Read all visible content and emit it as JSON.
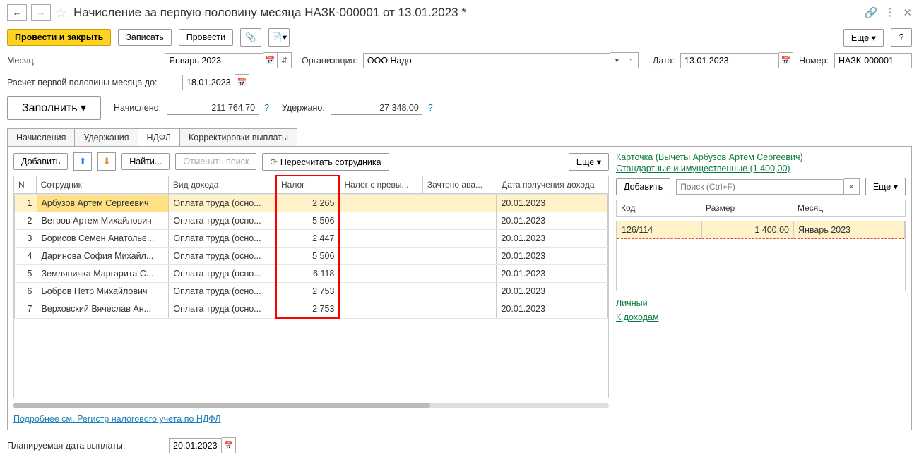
{
  "header": {
    "title": "Начисление за первую половину месяца НАЗК-000001 от 13.01.2023 *"
  },
  "toolbar": {
    "post_close": "Провести и закрыть",
    "save": "Записать",
    "post": "Провести",
    "more": "Еще"
  },
  "form": {
    "month_label": "Месяц:",
    "month_value": "Январь 2023",
    "org_label": "Организация:",
    "org_value": "ООО Надо",
    "date_label": "Дата:",
    "date_value": "13.01.2023",
    "number_label": "Номер:",
    "number_value": "НАЗК-000001",
    "calc_until_label": "Расчет первой половины месяца до:",
    "calc_until_value": "18.01.2023",
    "fill": "Заполнить",
    "accrued_label": "Начислено:",
    "accrued_value": "211 764,70",
    "withheld_label": "Удержано:",
    "withheld_value": "27 348,00"
  },
  "tabs": {
    "t1": "Начисления",
    "t2": "Удержания",
    "t3": "НДФЛ",
    "t4": "Корректировки выплаты"
  },
  "subbar": {
    "add": "Добавить",
    "find": "Найти...",
    "cancel_find": "Отменить поиск",
    "recalc": "Пересчитать сотрудника",
    "more": "Еще"
  },
  "cols": {
    "n": "N",
    "emp": "Сотрудник",
    "inc": "Вид дохода",
    "tax": "Налог",
    "exc": "Налог с превы...",
    "adv": "Зачтено ава...",
    "date": "Дата получения дохода"
  },
  "rows": [
    {
      "n": "1",
      "emp": "Арбузов Артем Сергеевич",
      "inc": "Оплата труда (осно...",
      "tax": "2 265",
      "date": "20.01.2023"
    },
    {
      "n": "2",
      "emp": "Ветров Артем Михайлович",
      "inc": "Оплата труда (осно...",
      "tax": "5 506",
      "date": "20.01.2023"
    },
    {
      "n": "3",
      "emp": "Борисов Семен Анатолье...",
      "inc": "Оплата труда (осно...",
      "tax": "2 447",
      "date": "20.01.2023"
    },
    {
      "n": "4",
      "emp": "Даринова София Михайл...",
      "inc": "Оплата труда (осно...",
      "tax": "5 506",
      "date": "20.01.2023"
    },
    {
      "n": "5",
      "emp": "Земляничка Маргарита С...",
      "inc": "Оплата труда (осно...",
      "tax": "6 118",
      "date": "20.01.2023"
    },
    {
      "n": "6",
      "emp": "Бобров Петр Михайлович",
      "inc": "Оплата труда (осно...",
      "tax": "2 753",
      "date": "20.01.2023"
    },
    {
      "n": "7",
      "emp": "Верховский Вячеслав Ан...",
      "inc": "Оплата труда (осно...",
      "tax": "2 753",
      "date": "20.01.2023"
    }
  ],
  "bottom_link": "Подробнее см. Регистр налогового учета по НДФЛ",
  "card": {
    "title": "Карточка (Вычеты Арбузов Артем Сергеевич)",
    "std_link": "Стандартные и имущественные (1 400,00)",
    "add": "Добавить",
    "search_ph": "Поиск (Ctrl+F)",
    "more": "Еще",
    "col_code": "Код",
    "col_size": "Размер",
    "col_month": "Месяц",
    "row_code": "126/114",
    "row_size": "1 400,00",
    "row_month": "Январь 2023",
    "link_personal": "Личный",
    "link_income": "К доходам"
  },
  "footer": {
    "planned_label": "Планируемая дата выплаты:",
    "planned_value": "20.01.2023"
  }
}
